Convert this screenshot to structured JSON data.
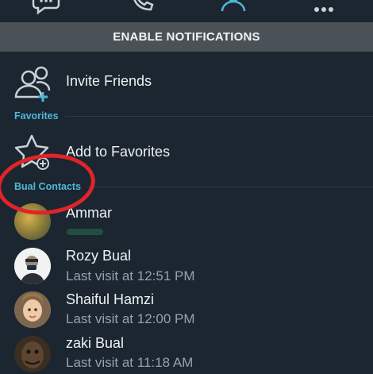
{
  "top_tabs": [
    {
      "name": "chats-icon"
    },
    {
      "name": "calls-icon"
    },
    {
      "name": "contacts-icon"
    },
    {
      "name": "more-icon"
    }
  ],
  "notification_banner": {
    "label": "ENABLE NOTIFICATIONS"
  },
  "invite": {
    "label": "Invite Friends"
  },
  "favorites": {
    "section_title": "Favorites",
    "add_label": "Add to Favorites"
  },
  "bual_contacts": {
    "section_title": "Bual Contacts"
  },
  "contacts": [
    {
      "name": "Ammar",
      "status": "",
      "online": true
    },
    {
      "name": "Rozy Bual",
      "status": "Last visit at 12:51 PM"
    },
    {
      "name": "Shaiful Hamzi",
      "status": "Last visit at 12:00 PM"
    },
    {
      "name": "zaki Bual",
      "status": "Last visit at 11:18 AM"
    }
  ],
  "colors": {
    "background": "#1b2630",
    "accent": "#4fb8d9",
    "banner": "#4a5258",
    "annotation": "#e0242a"
  }
}
